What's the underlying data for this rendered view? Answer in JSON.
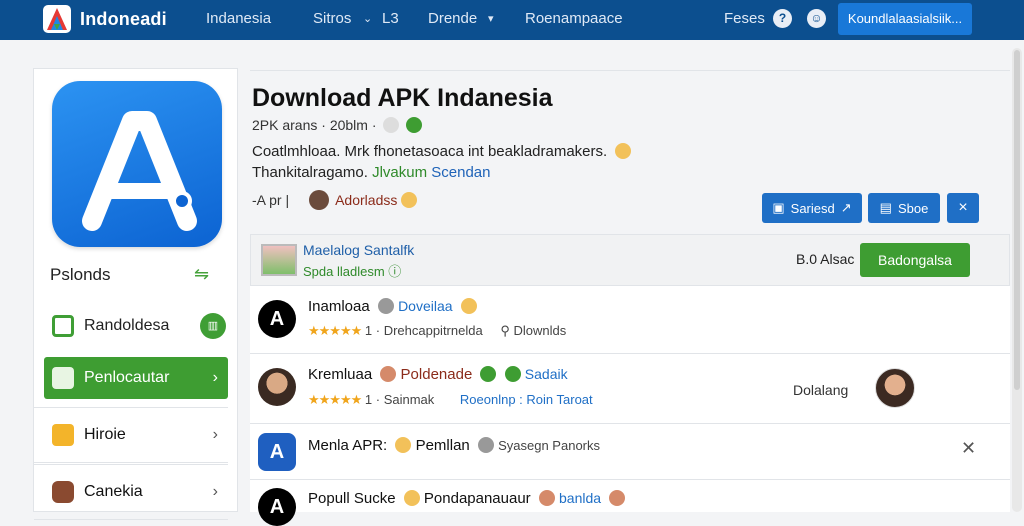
{
  "topbar": {
    "brand": "Indoneadi",
    "nav": [
      "Indanesia",
      "Sitros",
      "L3",
      "Drende",
      "Roenampaace"
    ],
    "feses": "Feses",
    "help_icon": "question-icon",
    "user_icon": "user-icon",
    "cta": "Koundlalaasialsiik..."
  },
  "sidebar": {
    "title": "Pslonds",
    "items": [
      {
        "label": "Randoldesa",
        "icon": "calendar-icon"
      },
      {
        "label": "Penlocautar",
        "icon": "flag-icon"
      },
      {
        "label": "Hiroie",
        "icon": "folder-icon"
      },
      {
        "label": "Canekia",
        "icon": "camera-icon"
      }
    ]
  },
  "main": {
    "title": "Download APK Indanesia",
    "meta": "2PK arans · 20blm ·",
    "desc_line1": "Coatlmhloaa. Mrk fhonetasoaca int beakladramakers.",
    "desc_line2_a": "Thankitalragamo.",
    "desc_line2_b": "Jlvakum",
    "desc_line2_c": "Scendan",
    "author_prefix": "-A pr |",
    "author_name": "Adorladss",
    "buttons": {
      "share": "Sariesd",
      "save": "Sboe",
      "close": "×"
    }
  },
  "featured": {
    "title": "Maelalog Santalfk",
    "subtitle": "Spda lladlesm",
    "price": "B.0 Alsac",
    "button": "Badongalsa"
  },
  "rows": [
    {
      "name": "Inamloaa",
      "tag": "Doveilaa",
      "rating_count": "1 · Drehcappitrnelda",
      "right": "Dlownlds"
    },
    {
      "name": "Kremluaa",
      "tag": "Poldenade",
      "tag2": "Sadaik",
      "rating_count": "1 · Sainmak",
      "link": "Roeonlnp : Roin Taroat",
      "right": "Dolalang"
    },
    {
      "name": "Menla APR:",
      "tag": "Pemllan",
      "tag2": "Syasegn Panorks"
    },
    {
      "name": "Popull Sucke",
      "tag": "Pondapanauaur",
      "tag2": "banlda"
    }
  ]
}
